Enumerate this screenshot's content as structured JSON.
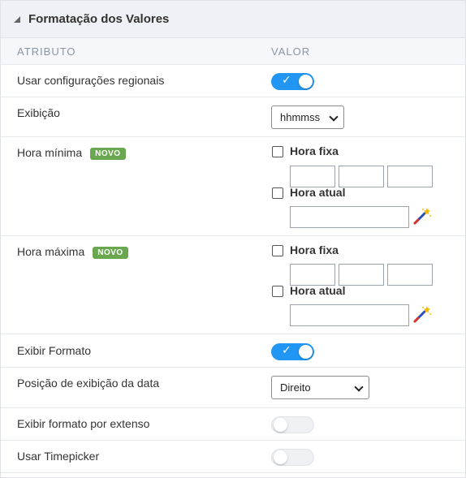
{
  "panel": {
    "title": "Formatação dos Valores",
    "collapse_icon": "collapse-triangle-icon"
  },
  "columns": {
    "attribute": "ATRIBUTO",
    "value": "VALOR"
  },
  "rows": {
    "regional": {
      "label": "Usar configurações regionais",
      "toggle": true
    },
    "exibicao": {
      "label": "Exibição",
      "select_value": "hhmmss"
    },
    "hora_minima": {
      "label": "Hora mínima",
      "badge": "NOVO",
      "fixed_label": "Hora fixa",
      "current_label": "Hora atual",
      "fixed_checked": false,
      "current_checked": false,
      "wand_icon": "magic-wand-icon"
    },
    "hora_maxima": {
      "label": "Hora máxima",
      "badge": "NOVO",
      "fixed_label": "Hora fixa",
      "current_label": "Hora atual",
      "fixed_checked": false,
      "current_checked": false,
      "wand_icon": "magic-wand-icon"
    },
    "exibir_formato": {
      "label": "Exibir Formato",
      "toggle": true
    },
    "posicao": {
      "label": "Posição de exibição da data",
      "select_value": "Direito"
    },
    "extenso": {
      "label": "Exibir formato por extenso",
      "toggle": false
    },
    "timepicker": {
      "label": "Usar Timepicker",
      "toggle": false
    }
  },
  "colors": {
    "toggle_on": "#2196f3",
    "badge": "#6aa84f",
    "header_bg": "#eef1f5"
  }
}
